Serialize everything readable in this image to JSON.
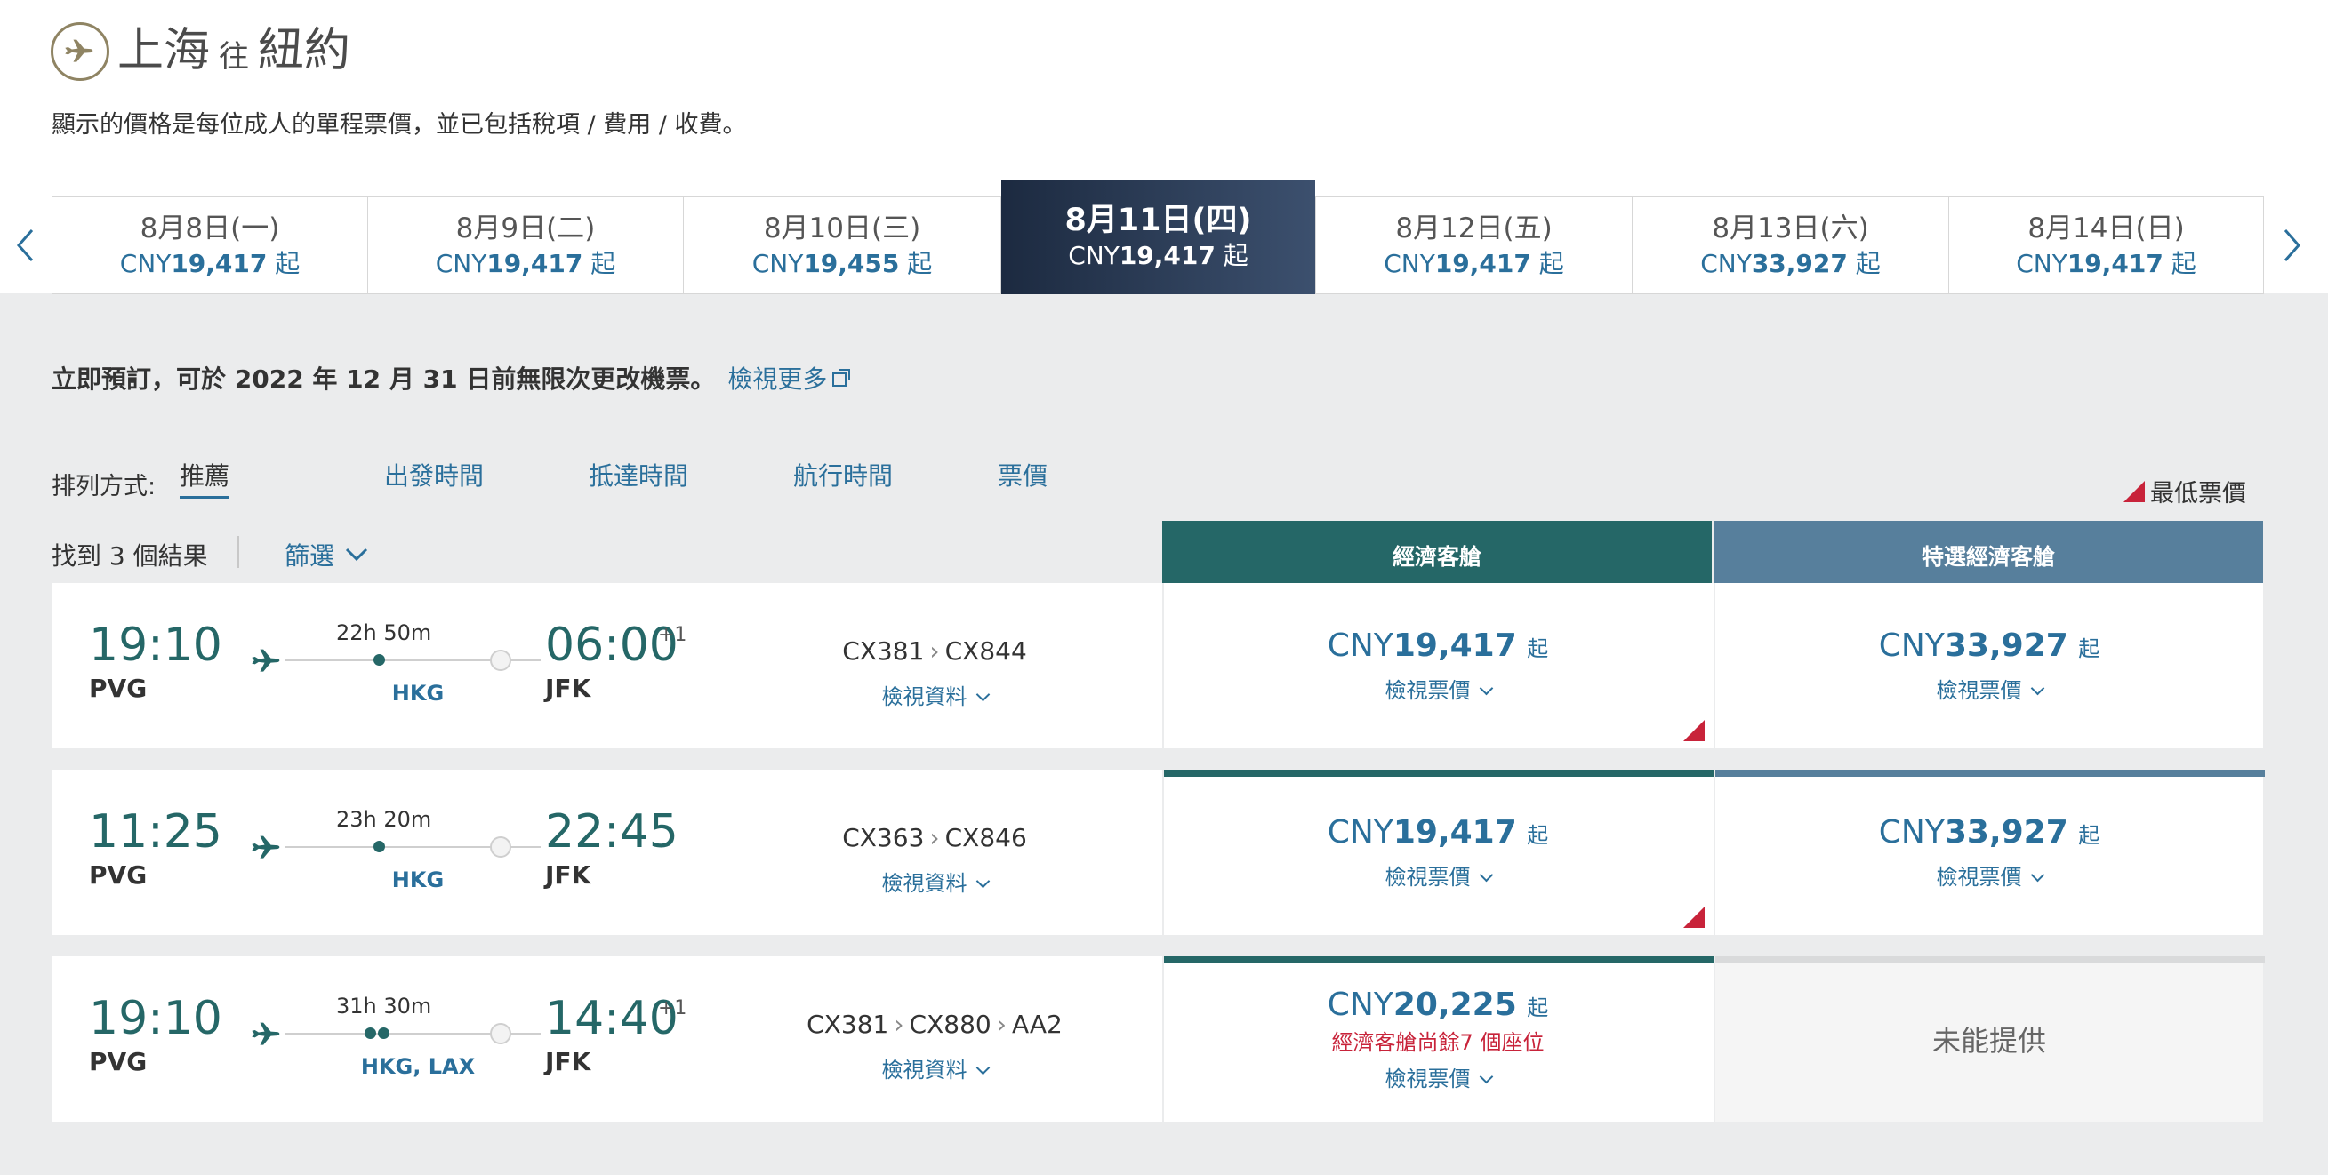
{
  "header": {
    "origin": "上海",
    "connector": "往",
    "destination": "紐約",
    "subtitle": "顯示的價格是每位成人的單程票價，並已包括稅項 / 費用 / 收費。"
  },
  "dates": [
    {
      "label": "8月8日(一)",
      "currency": "CNY",
      "amount": "19,417",
      "suffix": "起"
    },
    {
      "label": "8月9日(二)",
      "currency": "CNY",
      "amount": "19,417",
      "suffix": "起"
    },
    {
      "label": "8月10日(三)",
      "currency": "CNY",
      "amount": "19,455",
      "suffix": "起"
    },
    {
      "label": "8月11日(四)",
      "currency": "CNY",
      "amount": "19,417",
      "suffix": "起"
    },
    {
      "label": "8月12日(五)",
      "currency": "CNY",
      "amount": "19,417",
      "suffix": "起"
    },
    {
      "label": "8月13日(六)",
      "currency": "CNY",
      "amount": "33,927",
      "suffix": "起"
    },
    {
      "label": "8月14日(日)",
      "currency": "CNY",
      "amount": "19,417",
      "suffix": "起"
    }
  ],
  "selected_date_index": 3,
  "notice": {
    "text": "立即預訂，可於 2022 年 12 月 31 日前無限次更改機票。",
    "link": "檢視更多"
  },
  "sort": {
    "label": "排列方式:",
    "options": [
      "推薦",
      "出發時間",
      "抵達時間",
      "航行時間",
      "票價"
    ],
    "active": "推薦"
  },
  "lowest_fare_label": "最低票價",
  "results": {
    "found": "找到 3 個結果",
    "filter": "篩選"
  },
  "cabins": {
    "economy": "經濟客艙",
    "premium": "特選經濟客艙"
  },
  "flights": [
    {
      "dep_time": "19:10",
      "dep_code": "PVG",
      "duration": "22h 50m",
      "via": "HKG",
      "arr_time": "06:00",
      "plus": "+1",
      "arr_code": "JFK",
      "numbers": [
        "CX381",
        "CX844"
      ],
      "details": "檢視資料",
      "economy": {
        "currency": "CNY",
        "amount": "19,417",
        "suffix": "起",
        "view": "檢視票價",
        "seats": "",
        "lowest": true
      },
      "premium": {
        "currency": "CNY",
        "amount": "33,927",
        "suffix": "起",
        "view": "檢視票價",
        "available": true
      }
    },
    {
      "dep_time": "11:25",
      "dep_code": "PVG",
      "duration": "23h 20m",
      "via": "HKG",
      "arr_time": "22:45",
      "plus": "",
      "arr_code": "JFK",
      "numbers": [
        "CX363",
        "CX846"
      ],
      "details": "檢視資料",
      "economy": {
        "currency": "CNY",
        "amount": "19,417",
        "suffix": "起",
        "view": "檢視票價",
        "seats": "",
        "lowest": true
      },
      "premium": {
        "currency": "CNY",
        "amount": "33,927",
        "suffix": "起",
        "view": "檢視票價",
        "available": true
      }
    },
    {
      "dep_time": "19:10",
      "dep_code": "PVG",
      "duration": "31h 30m",
      "via": "HKG, LAX",
      "arr_time": "14:40",
      "plus": "+1",
      "arr_code": "JFK",
      "numbers": [
        "CX381",
        "CX880",
        "AA2"
      ],
      "details": "檢視資料",
      "economy": {
        "currency": "CNY",
        "amount": "20,225",
        "suffix": "起",
        "view": "檢視票價",
        "seats": "經濟客艙尚餘7 個座位",
        "lowest": false
      },
      "premium": {
        "available": false,
        "na_text": "未能提供"
      }
    }
  ],
  "colors": {
    "economy": "#256767",
    "premium": "#577f9c",
    "link": "#2a6f9b",
    "lowest": "#c8233a"
  }
}
